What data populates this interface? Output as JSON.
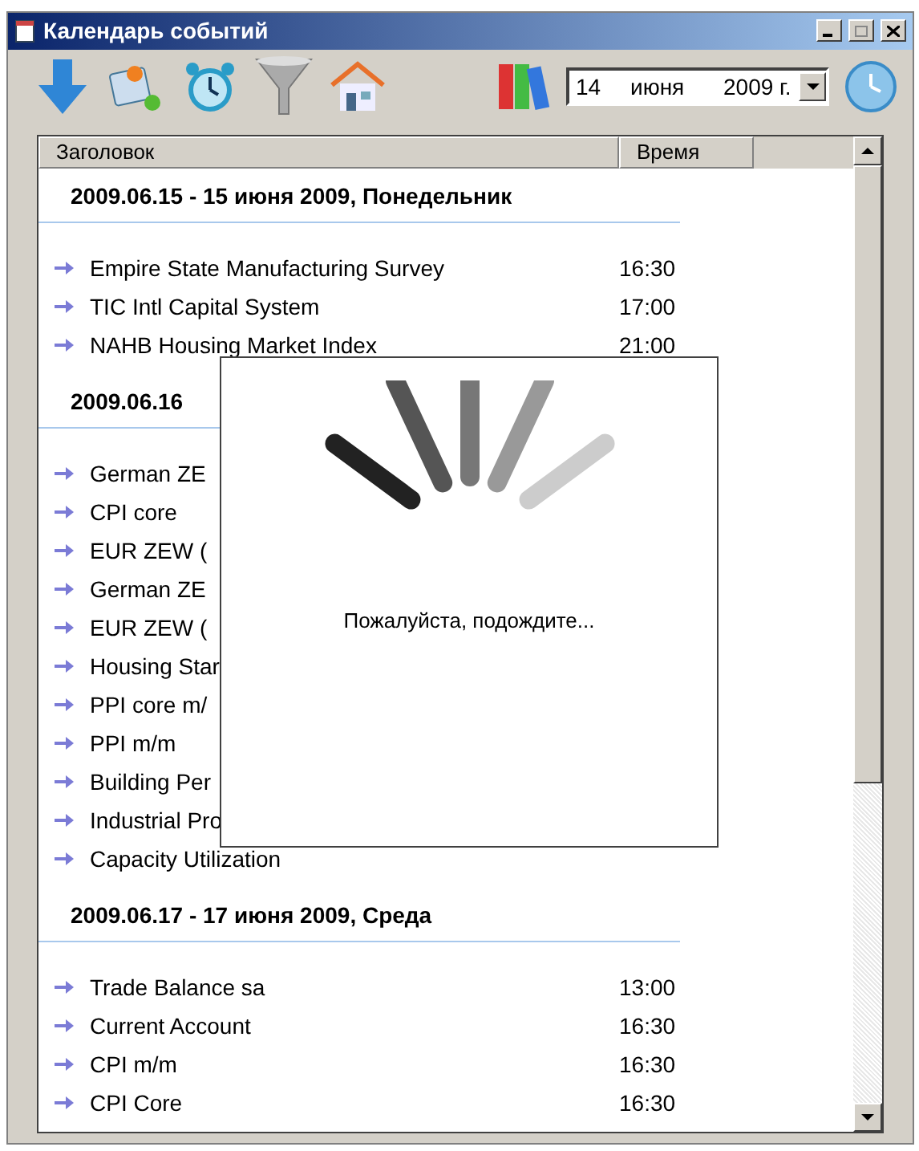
{
  "window": {
    "title": "Календарь событий"
  },
  "date_picker": {
    "day": "14",
    "month": "июня",
    "year": "2009 г."
  },
  "table": {
    "columns": [
      "Заголовок",
      "Время"
    ]
  },
  "groups": [
    {
      "heading": "2009.06.15 - 15 июня 2009, Понедельник",
      "events": [
        {
          "title": "Empire State Manufacturing Survey",
          "time": "16:30"
        },
        {
          "title": "TIC Intl Capital System",
          "time": "17:00"
        },
        {
          "title": "NAHB Housing Market Index",
          "time": "21:00"
        }
      ]
    },
    {
      "heading": "2009.06.16",
      "events": [
        {
          "title": "German ZE"
        },
        {
          "title": "CPI core"
        },
        {
          "title": "EUR ZEW ("
        },
        {
          "title": "German ZE"
        },
        {
          "title": "EUR ZEW ("
        },
        {
          "title": "Housing Star"
        },
        {
          "title": "PPI core m/"
        },
        {
          "title": "PPI m/m"
        },
        {
          "title": "Building Per"
        },
        {
          "title": "Industrial Pro"
        },
        {
          "title": "Capacity Utilization"
        }
      ]
    },
    {
      "heading": "2009.06.17 - 17 июня 2009, Среда",
      "events": [
        {
          "title": "Trade Balance sa",
          "time": "13:00"
        },
        {
          "title": "Current Account",
          "time": "16:30"
        },
        {
          "title": "CPI m/m",
          "time": "16:30"
        },
        {
          "title": "CPI Core",
          "time": "16:30"
        }
      ]
    }
  ],
  "dialog": {
    "message": "Пожалуйста, подождите..."
  }
}
